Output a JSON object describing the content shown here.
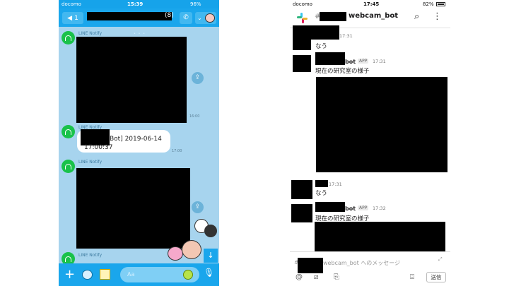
{
  "line": {
    "status": {
      "carrier": "docomo",
      "time": "15:39",
      "battery": "96%"
    },
    "header": {
      "back_count": "1",
      "member_count": "(8)"
    },
    "messages": [
      {
        "sender": "LINE Notify",
        "time": "16:00"
      },
      {
        "sender": "LINE Notify",
        "text_line1": "Bot] 2019-06-14",
        "text_line2": "17:00:37",
        "time": "17:00"
      },
      {
        "sender": "LINE Notify"
      },
      {
        "sender": "LINE Notify"
      }
    ],
    "input": {
      "placeholder": "Aa"
    }
  },
  "slack": {
    "status": {
      "carrier": "docomo",
      "time": "17:45",
      "battery": "82%"
    },
    "header": {
      "channel_hash": "#",
      "channel_name": "webcam_bot"
    },
    "messages": [
      {
        "time": "17:31",
        "text": "なう"
      },
      {
        "name": "bot",
        "tag": "APP",
        "time": "17:31",
        "text": "現在の研究室の様子"
      },
      {
        "time": "17:31",
        "text": "なう"
      },
      {
        "name": "bot",
        "tag": "APP",
        "time": "17:32",
        "text": "現在の研究室の様子"
      }
    ],
    "composer": {
      "hash": "#",
      "placeholder": "webcam_bot へのメッセージ",
      "send_label": "送信"
    }
  },
  "colors": {
    "line_blue": "#1aa6ec",
    "line_bg": "#a7d4ee",
    "line_green": "#19c24a"
  }
}
